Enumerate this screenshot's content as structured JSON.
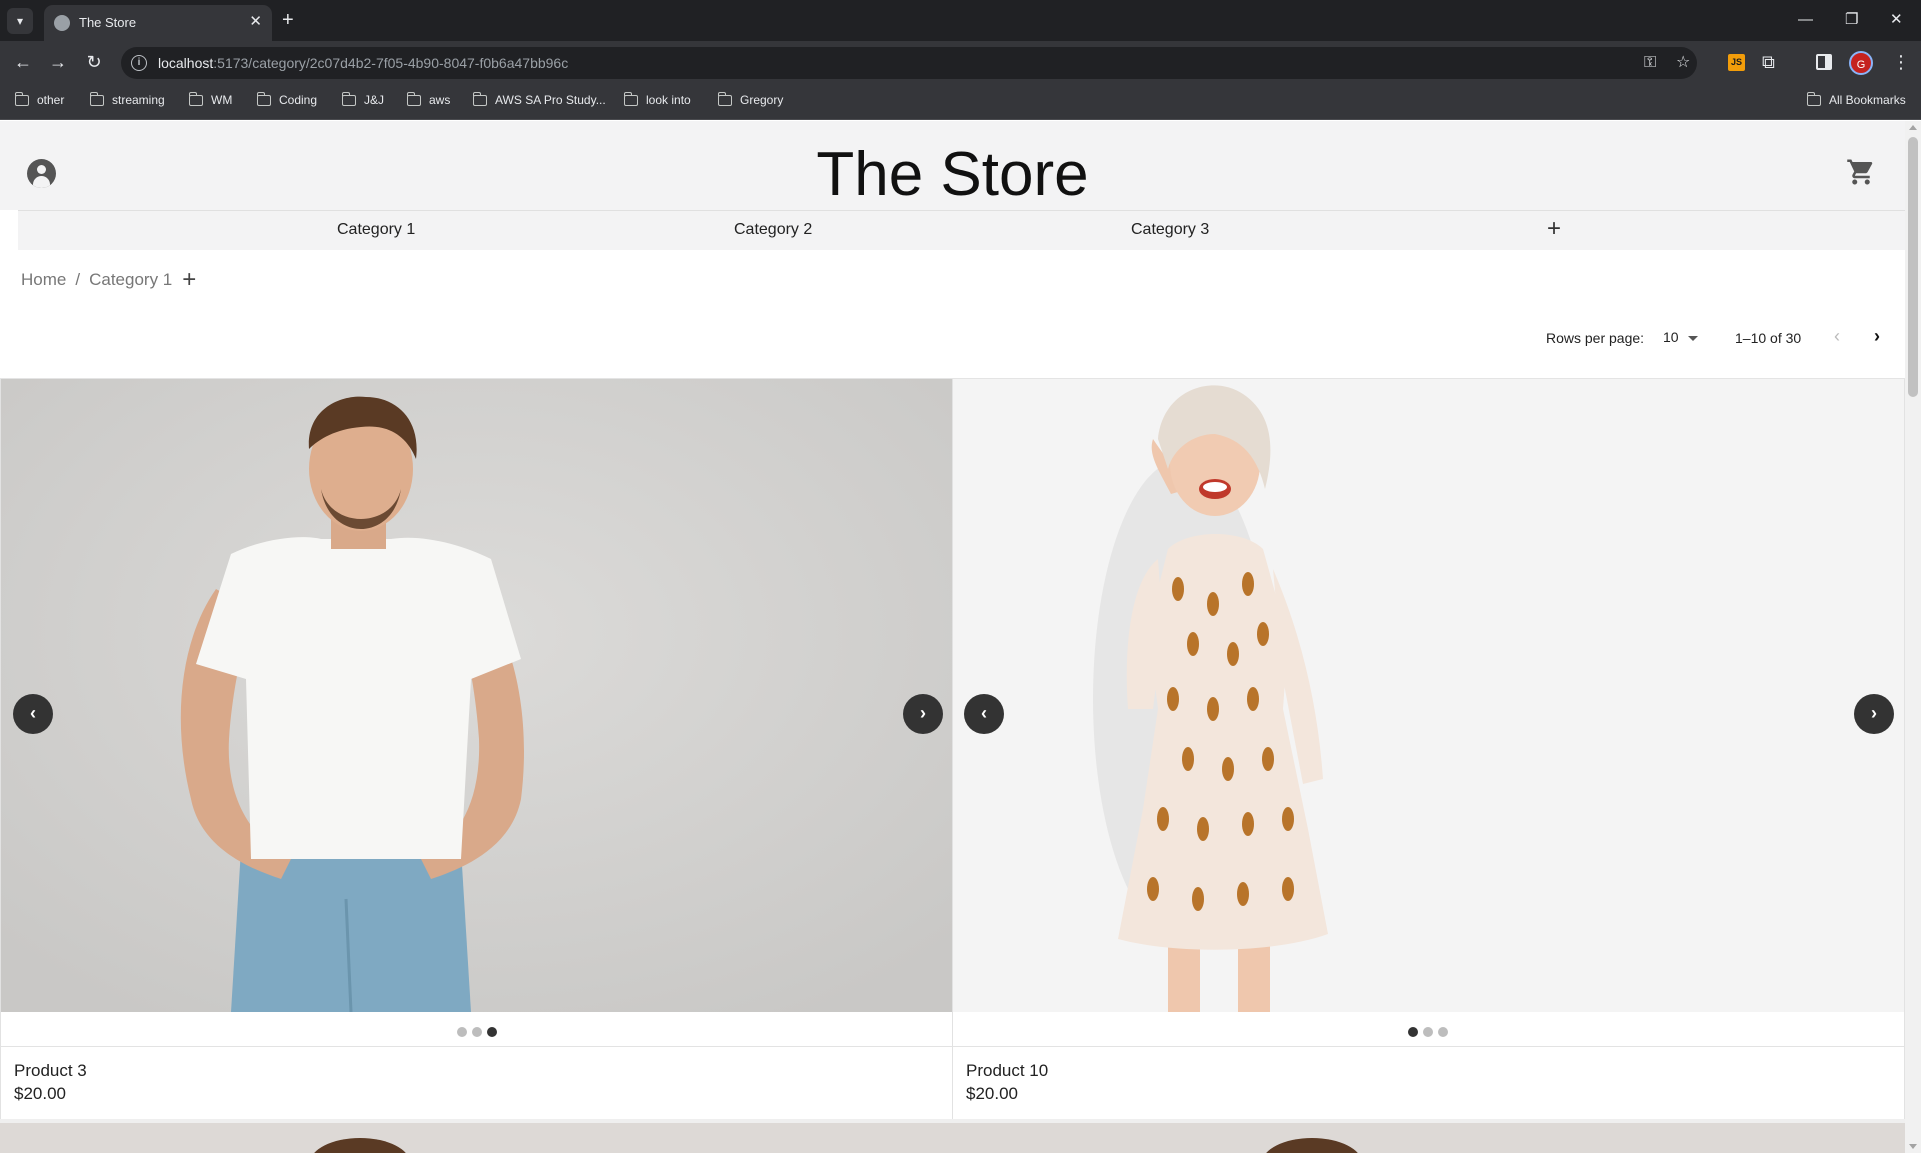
{
  "browser": {
    "tab_title": "The Store",
    "url_host": "localhost",
    "url_path": ":5173/category/2c07d4b2-7f05-4b90-8047-f0b6a47bb96c",
    "profile_initial": "G",
    "extension_label": "JS",
    "bookmarks": [
      "other",
      "streaming",
      "WM",
      "Coding",
      "J&J",
      "aws",
      "AWS SA Pro Study...",
      "look into",
      "Gregory"
    ],
    "all_bookmarks": "All Bookmarks"
  },
  "store": {
    "title": "The Store",
    "categories": [
      "Category 1",
      "Category 2",
      "Category 3"
    ],
    "breadcrumb": {
      "home": "Home",
      "separator": "/",
      "current": "Category 1"
    },
    "pagination": {
      "rows_label": "Rows per page:",
      "rows_value": "10",
      "range": "1–10 of 30"
    },
    "products": [
      {
        "name": "Product 3",
        "price": "$20.00",
        "active_slide": 3
      },
      {
        "name": "Product 10",
        "price": "$20.00",
        "active_slide": 1
      }
    ]
  },
  "colors": {
    "header_bg": "#f3f3f4",
    "carousel_button": "#333333",
    "accent_js": "#f29d0a"
  }
}
